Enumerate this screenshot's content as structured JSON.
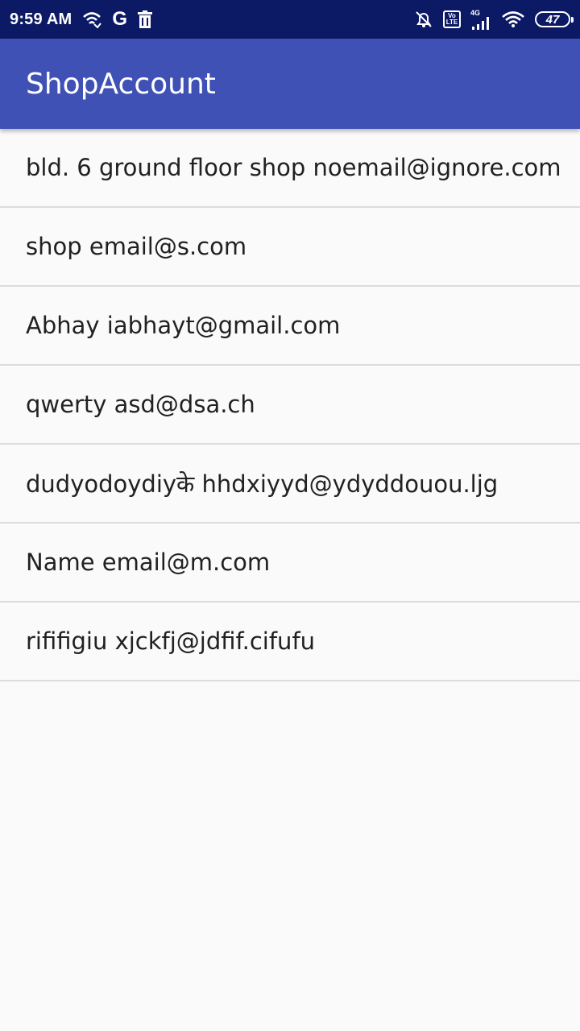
{
  "status_bar": {
    "time": "9:59 AM",
    "network": "4G",
    "volte_top": "Vo",
    "volte_bottom": "LTE",
    "battery": "47",
    "icons": [
      "wifi-calling-icon",
      "google-icon",
      "trash-icon",
      "alarm-off-icon",
      "volte-icon",
      "signal-icon",
      "wifi-icon",
      "battery-icon"
    ]
  },
  "app_bar": {
    "title": "ShopAccount",
    "color": "#3f51b5"
  },
  "accounts": [
    "bld. 6 ground floor shop noemail@ignore.com",
    "shop email@s.com",
    "Abhay iabhayt@gmail.com",
    "qwerty asd@dsa.ch",
    "dudyodoydiyके hhdxiyyd@ydyddouou.ljg",
    "Name email@m.com",
    "rififigiu xjckfj@jdfif.cifufu"
  ]
}
